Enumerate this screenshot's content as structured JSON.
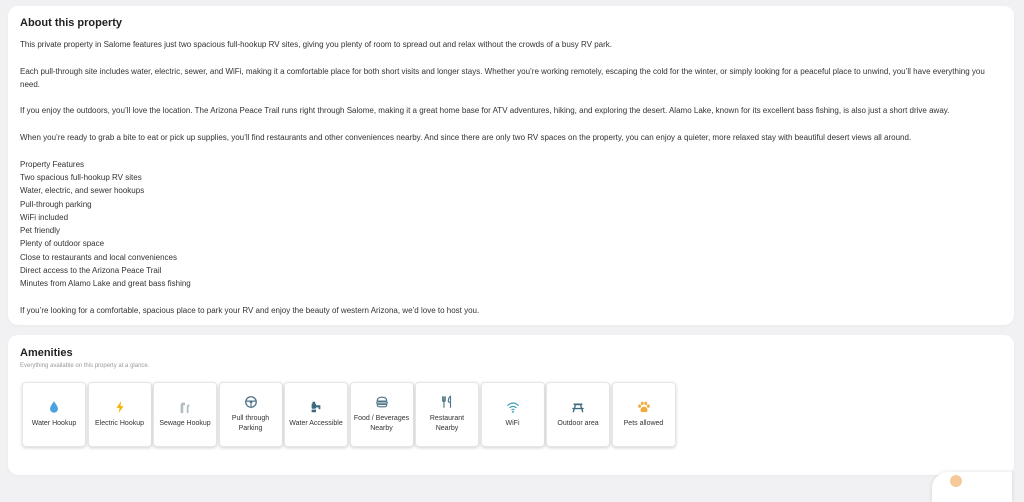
{
  "about": {
    "title": "About this property",
    "paragraphs": [
      "This private property in Salome features just two spacious full-hookup RV sites, giving you plenty of room to spread out and relax without the crowds of a busy RV park.",
      "Each pull-through site includes water, electric, sewer, and WiFi, making it a comfortable place for both short visits and longer stays. Whether you’re working remotely, escaping the cold for the winter, or simply looking for a peaceful place to unwind, you’ll have everything you need.",
      "If you enjoy the outdoors, you’ll love the location. The Arizona Peace Trail runs right through Salome, making it a great home base for ATV adventures, hiking, and exploring the desert. Alamo Lake, known for its excellent bass fishing, is also just a short drive away.",
      "When you’re ready to grab a bite to eat or pick up supplies, you’ll find restaurants and other conveniences nearby. And since there are only two RV spaces on the property, you can enjoy a quieter, more relaxed stay with beautiful desert views all around."
    ],
    "features_heading": "Property Features",
    "features": [
      "Two spacious full-hookup RV sites",
      "Water, electric, and sewer hookups",
      "Pull-through parking",
      "WiFi included",
      "Pet friendly",
      "Plenty of outdoor space",
      "Close to restaurants and local conveniences",
      "Direct access to the Arizona Peace Trail",
      "Minutes from Alamo Lake and great bass fishing"
    ],
    "closing": "If you’re looking for a comfortable, spacious place to park your RV and enjoy the beauty of western Arizona, we’d love to host you."
  },
  "amenities": {
    "title": "Amenities",
    "subtitle": "Everything available on this property at a glance.",
    "items": [
      {
        "label": "Water Hookup",
        "icon": "water-drop-icon",
        "color": "#4aa3e0"
      },
      {
        "label": "Electric Hookup",
        "icon": "electric-bolt-icon",
        "color": "#f4b400"
      },
      {
        "label": "Sewage Hookup",
        "icon": "pipe-icon",
        "color": "#9aa5ad"
      },
      {
        "label": "Pull through Parking",
        "icon": "steering-wheel-icon",
        "color": "#4f7488"
      },
      {
        "label": "Water Accessible",
        "icon": "water-tap-icon",
        "color": "#3e6a7e"
      },
      {
        "label": "Food / Beverages Nearby",
        "icon": "food-icon",
        "color": "#4f7488"
      },
      {
        "label": "Restaurant Nearby",
        "icon": "utensils-icon",
        "color": "#4f7488"
      },
      {
        "label": "WiFi",
        "icon": "wifi-icon",
        "color": "#4aa3b8"
      },
      {
        "label": "Outdoor area",
        "icon": "picnic-table-icon",
        "color": "#3e6a7e"
      },
      {
        "label": "Pets allowed",
        "icon": "paw-icon",
        "color": "#f2a93b"
      }
    ]
  }
}
